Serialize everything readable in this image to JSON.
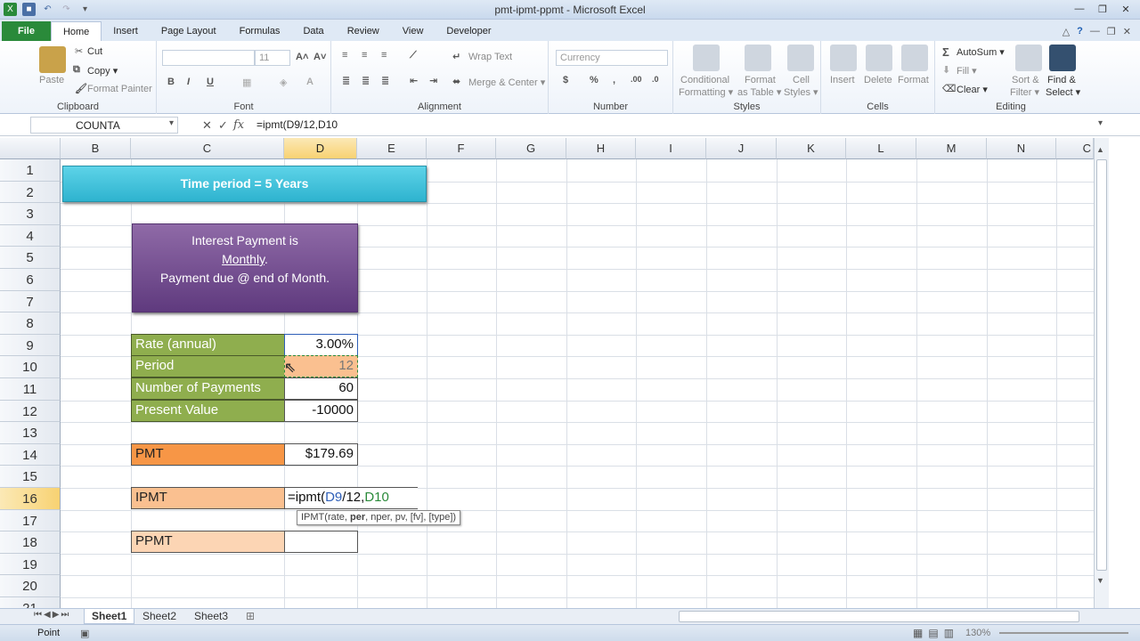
{
  "window": {
    "title": "pmt-ipmt-ppmt - Microsoft Excel"
  },
  "tabs": [
    "File",
    "Home",
    "Insert",
    "Page Layout",
    "Formulas",
    "Data",
    "Review",
    "View",
    "Developer"
  ],
  "ribbon": {
    "clipboard": {
      "paste": "Paste",
      "cut": "Cut",
      "copy": "Copy ▾",
      "format_painter": "Format Painter",
      "label": "Clipboard"
    },
    "font": {
      "size": "11",
      "label": "Font"
    },
    "alignment": {
      "wrap": "Wrap Text",
      "merge": "Merge & Center ▾",
      "label": "Alignment"
    },
    "number": {
      "format": "Currency",
      "label": "Number"
    },
    "styles": {
      "conditional": "Conditional",
      "conditional2": "Formatting ▾",
      "format_table": "Format",
      "format_table2": "as Table ▾",
      "cell_styles": "Cell",
      "cell_styles2": "Styles ▾",
      "label": "Styles"
    },
    "cells": {
      "insert": "Insert",
      "delete": "Delete",
      "format": "Format",
      "label": "Cells"
    },
    "editing": {
      "autosum": "AutoSum ▾",
      "fill": "Fill ▾",
      "clear": "Clear ▾",
      "sort": "Sort &",
      "sort2": "Filter ▾",
      "find": "Find &",
      "find2": "Select ▾",
      "label": "Editing"
    }
  },
  "formula_bar": {
    "name_box": "COUNTA",
    "formula": "=ipmt(D9/12,D10"
  },
  "columns": [
    "B",
    "C",
    "D",
    "E",
    "F",
    "G",
    "H",
    "I",
    "J",
    "K",
    "L",
    "M",
    "N",
    "C"
  ],
  "rows": [
    "1",
    "2",
    "3",
    "4",
    "5",
    "6",
    "7",
    "8",
    "9",
    "10",
    "11",
    "12",
    "13",
    "14",
    "15",
    "16",
    "17",
    "18",
    "19",
    "20",
    "21"
  ],
  "banner": "Time period = 5 Years",
  "note": {
    "line1": "Interest Payment is",
    "line2": "Monthly",
    "line2_suffix": ".",
    "line3": "Payment due @ end of Month."
  },
  "table": [
    {
      "label": "Rate (annual)",
      "value": "3.00%"
    },
    {
      "label": "Period",
      "value": "12"
    },
    {
      "label": "Number of Payments",
      "value": "60"
    },
    {
      "label": "Present Value",
      "value": "-10000"
    }
  ],
  "pmt": {
    "label": "PMT",
    "value": "$179.69"
  },
  "ipmt": {
    "label": "IPMT",
    "edit_prefix": "=ipmt(",
    "ref1": "D9",
    "mid": "/12,",
    "ref2": "D10"
  },
  "ppmt": {
    "label": "PPMT"
  },
  "tooltip": {
    "pre": "IPMT(rate, ",
    "bold": "per",
    "post": ", nper, pv, [fv], [type])"
  },
  "sheets": [
    "Sheet1",
    "Sheet2",
    "Sheet3"
  ],
  "status": {
    "mode": "Point",
    "zoom": "130%"
  },
  "colors": {
    "banner": "#2eb3cf",
    "label_green": "#8fae4e",
    "pmt_orange": "#f79646",
    "ipmt_peach": "#fac090",
    "ppmt_peach": "#fcd5b4",
    "purple": "#6f4a8e"
  }
}
